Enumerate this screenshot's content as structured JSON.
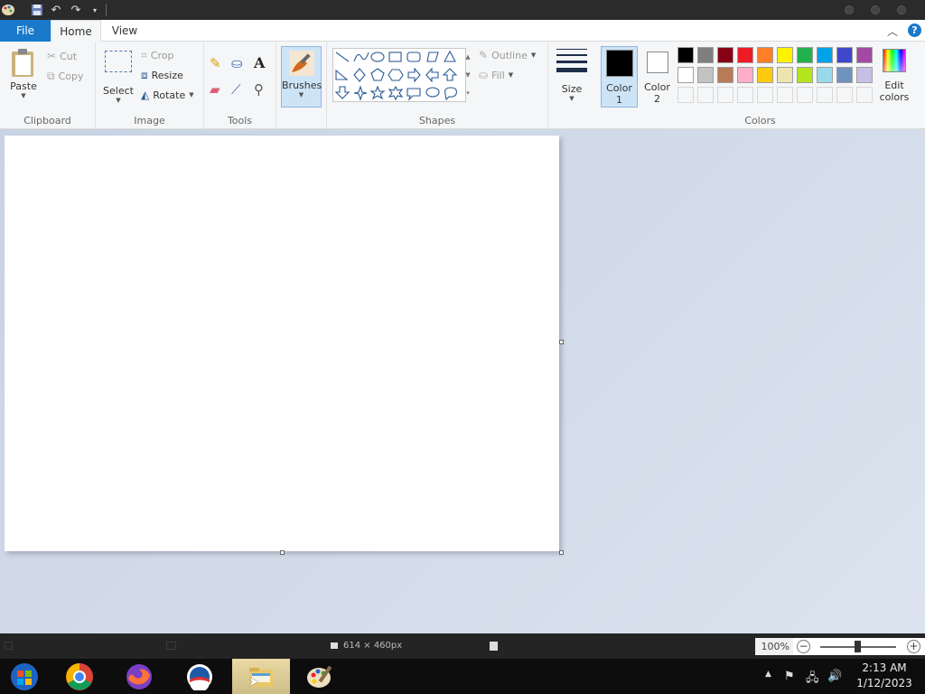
{
  "tabs": {
    "file": "File",
    "home": "Home",
    "view": "View"
  },
  "clipboard": {
    "paste": "Paste",
    "cut": "Cut",
    "copy": "Copy",
    "label": "Clipboard"
  },
  "image": {
    "select": "Select",
    "crop": "Crop",
    "resize": "Resize",
    "rotate": "Rotate",
    "label": "Image"
  },
  "tools": {
    "label": "Tools"
  },
  "brushes": {
    "label": "Brushes"
  },
  "shapes": {
    "outline": "Outline",
    "fill": "Fill",
    "label": "Shapes"
  },
  "size": {
    "label": "Size"
  },
  "colors": {
    "color1_line1": "Color",
    "color1_line2": "1",
    "color2_line1": "Color",
    "color2_line2": "2",
    "edit_line1": "Edit",
    "edit_line2": "colors",
    "label": "Colors",
    "color1_value": "#000000",
    "color2_value": "#ffffff",
    "palette_row1": [
      "#000000",
      "#7f7f7f",
      "#880015",
      "#ed1c24",
      "#ff7f27",
      "#fff200",
      "#22b14c",
      "#00a2e8",
      "#3f48cc",
      "#a349a4"
    ],
    "palette_row2": [
      "#ffffff",
      "#c3c3c3",
      "#b97a57",
      "#ffaec9",
      "#ffc90e",
      "#efe4b0",
      "#b5e61d",
      "#99d9ea",
      "#7092be",
      "#c8bfe7"
    ]
  },
  "status": {
    "canvas_size": "614 × 460px",
    "zoom": "100%"
  },
  "taskbar": {
    "time": "2:13 AM",
    "date": "1/12/2023"
  }
}
